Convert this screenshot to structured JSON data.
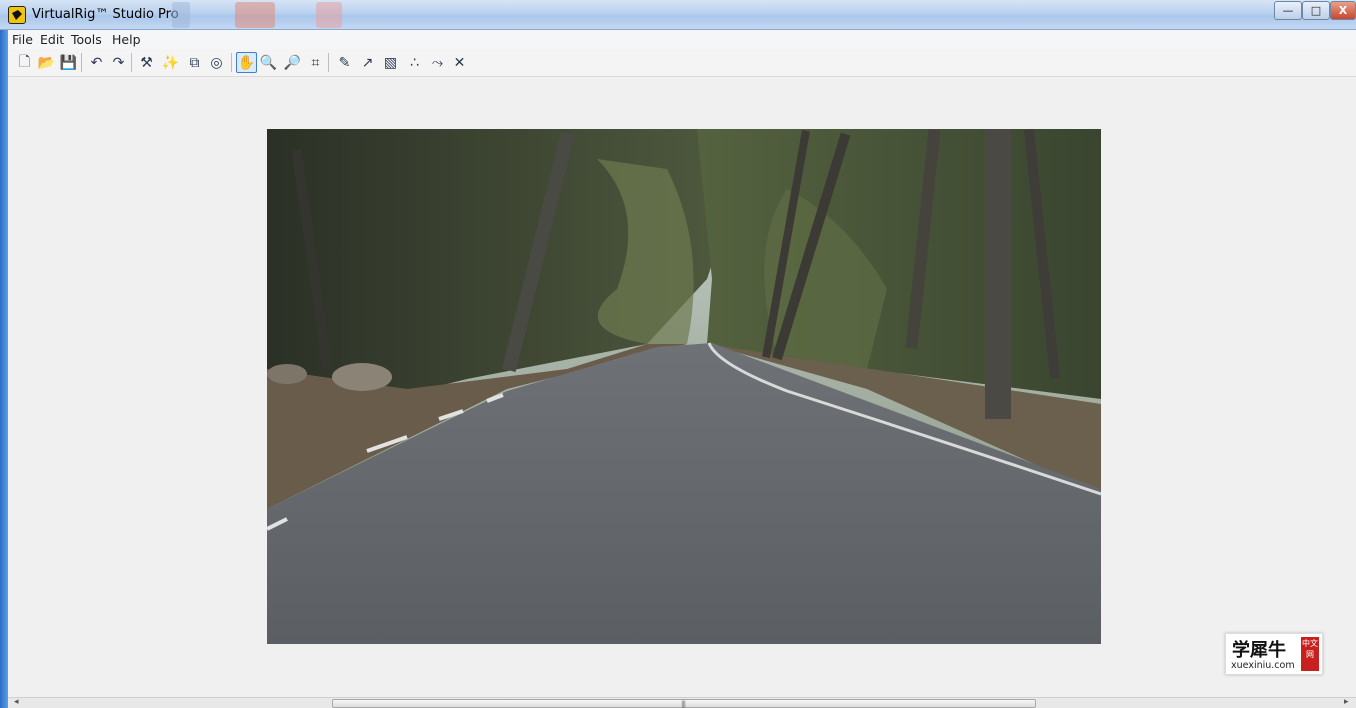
{
  "window": {
    "title": "VirtualRig™ Studio Pro",
    "controls": {
      "minimize": "—",
      "maximize": "□",
      "close": "X"
    }
  },
  "menu": [
    {
      "label": "File"
    },
    {
      "label": "Edit"
    },
    {
      "label": "Tools"
    },
    {
      "label": "Help"
    }
  ],
  "toolbar": {
    "buttons": [
      {
        "name": "new-file-icon",
        "glyph": "🗋"
      },
      {
        "name": "open-folder-icon",
        "glyph": "📂"
      },
      {
        "name": "save-icon",
        "glyph": "💾"
      },
      {
        "name": "undo-icon",
        "glyph": "↶"
      },
      {
        "name": "redo-icon",
        "glyph": "↷"
      },
      {
        "name": "tools-icon",
        "glyph": "⚒"
      },
      {
        "name": "wand-icon",
        "glyph": "✨"
      },
      {
        "name": "layers-icon",
        "glyph": "⧉"
      },
      {
        "name": "rig-icon",
        "glyph": "◎"
      },
      {
        "name": "pan-hand-icon",
        "glyph": "✋",
        "active": true
      },
      {
        "name": "zoom-in-icon",
        "glyph": "🔍"
      },
      {
        "name": "zoom-out-icon",
        "glyph": "🔎"
      },
      {
        "name": "zoom-fit-icon",
        "glyph": "⌗"
      },
      {
        "name": "draw-line-icon",
        "glyph": "✎"
      },
      {
        "name": "draw-arrow-icon",
        "glyph": "↗"
      },
      {
        "name": "select-region-icon",
        "glyph": "▧"
      },
      {
        "name": "points-icon",
        "glyph": "∴"
      },
      {
        "name": "path-icon",
        "glyph": "⤳"
      },
      {
        "name": "delete-icon",
        "glyph": "✕"
      }
    ]
  },
  "watermark": {
    "title": "学犀牛",
    "url": "xuexiniu.com",
    "badge": "中文网"
  },
  "scrollbar": {
    "left_arrow": "◂",
    "right_arrow": "▸",
    "grip": "|||"
  }
}
